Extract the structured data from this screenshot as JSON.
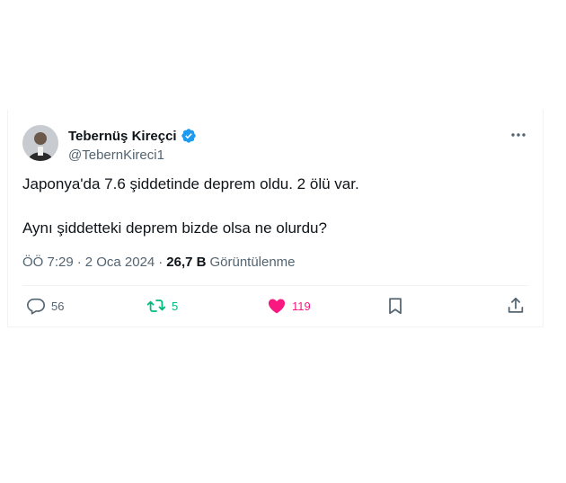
{
  "tweet": {
    "author_name": "Tebernüş Kireçci",
    "handle": "@TebernKireci1",
    "line1": "Japonya'da 7.6 şiddetinde deprem oldu. 2 ölü var.",
    "line2": "Aynı şiddetteki deprem bizde olsa ne olurdu?",
    "time": "ÖÖ 7:29",
    "separator": "·",
    "date": "2 Oca 2024",
    "views_count": "26,7 B",
    "views_label": "Görüntülenme"
  },
  "actions": {
    "reply_count": "56",
    "retweet_count": "5",
    "like_count": "119"
  },
  "colors": {
    "verified": "#1d9bf0",
    "retweet": "#00ba7c",
    "like": "#f91880",
    "secondary_text": "#536471"
  },
  "icons": [
    "avatar",
    "verified-badge-icon",
    "more-icon",
    "reply-icon",
    "retweet-icon",
    "heart-icon",
    "bookmark-icon",
    "share-icon"
  ]
}
